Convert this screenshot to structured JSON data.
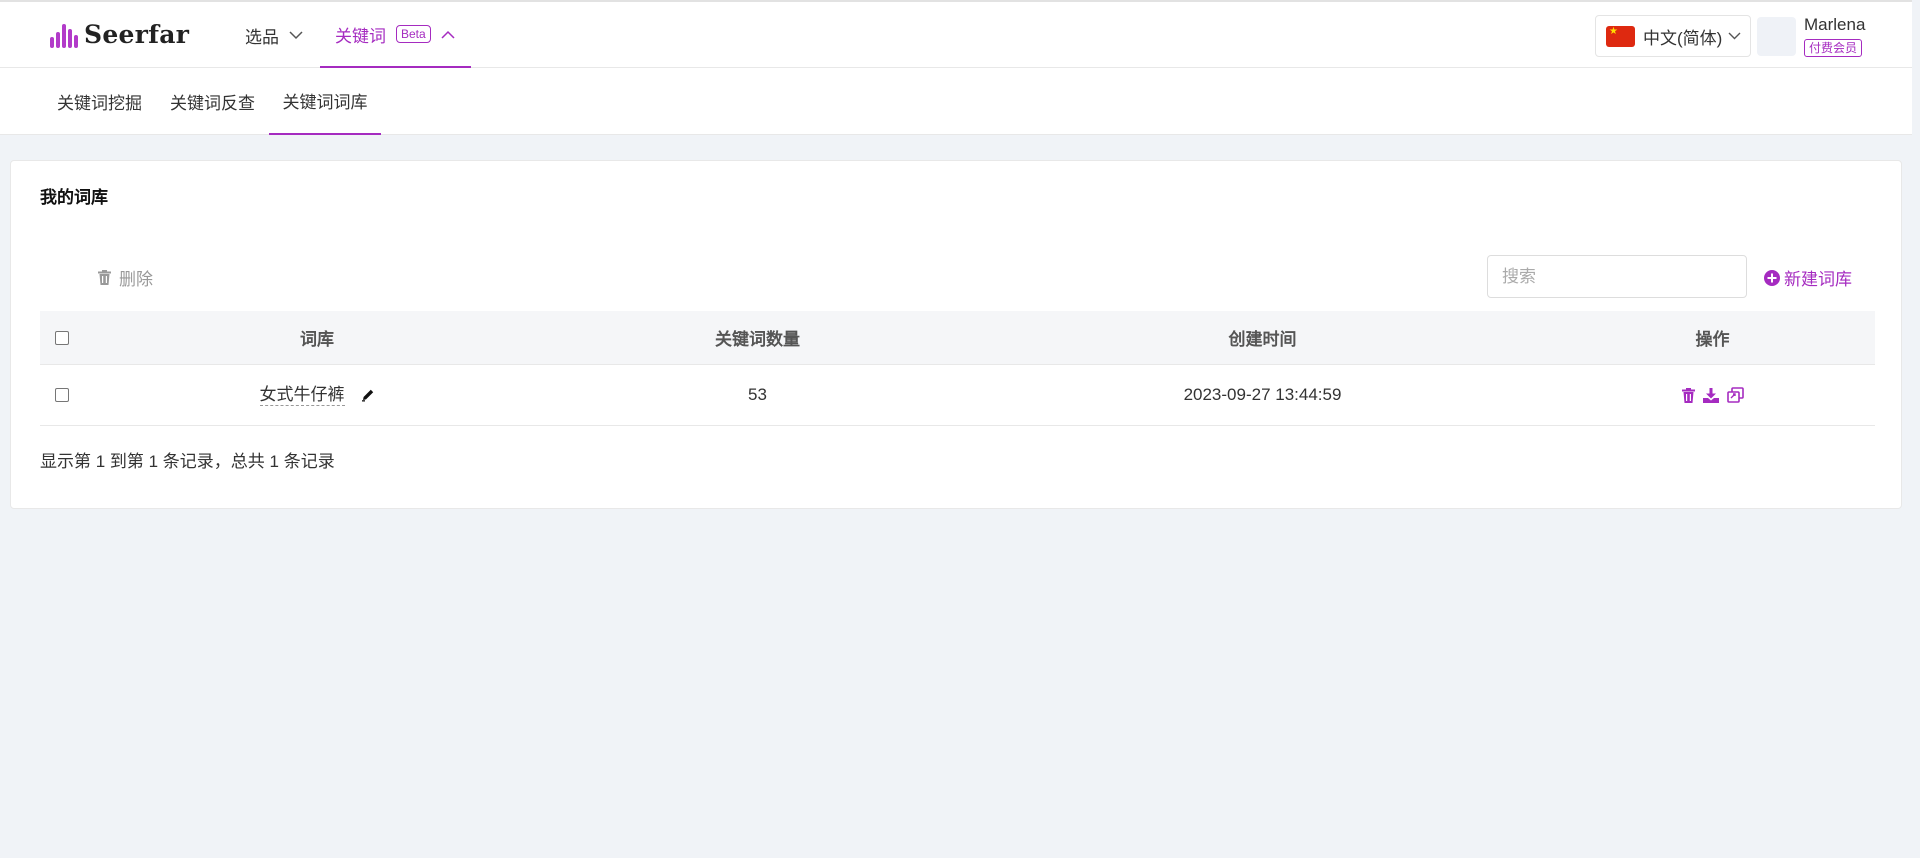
{
  "brand": {
    "name": "Seerfar",
    "color": "#a52bc0"
  },
  "topnav": {
    "items": [
      {
        "label": "选品",
        "icon": "chevron-down-icon"
      },
      {
        "label": "关键词",
        "badge": "Beta",
        "icon": "chevron-up-icon",
        "active": true
      }
    ]
  },
  "language": {
    "label": "中文(简体)",
    "flag": "china-flag-icon"
  },
  "user": {
    "name": "Marlena",
    "badge": "付费会员"
  },
  "subnav": {
    "tabs": [
      {
        "label": "关键词挖掘"
      },
      {
        "label": "关键词反查"
      },
      {
        "label": "关键词词库",
        "active": true
      }
    ]
  },
  "card": {
    "title": "我的词库",
    "delete_label": "删除",
    "search_placeholder": "搜索",
    "new_label": "新建词库"
  },
  "table": {
    "columns": [
      "词库",
      "关键词数量",
      "创建时间",
      "操作"
    ],
    "rows": [
      {
        "name": "女式牛仔裤",
        "count": "53",
        "created": "2023-09-27 13:44:59",
        "actions": [
          "trash-icon",
          "download-icon",
          "copy-icon"
        ]
      }
    ],
    "summary": "显示第 1 到第 1 条记录，总共 1 条记录"
  }
}
